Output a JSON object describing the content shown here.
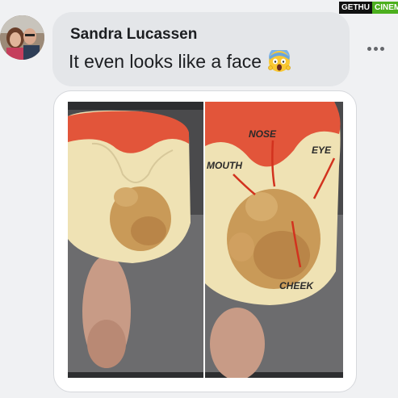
{
  "watermark": {
    "left": "GETHU",
    "right": "CINEMA"
  },
  "comment": {
    "author": "Sandra Lucassen",
    "text": "It even looks like a face",
    "emoji_icon": "face-screaming-in-fear-icon",
    "more_icon": "more-options-icon"
  },
  "attachment": {
    "annotations": {
      "nose": "NOSE",
      "eye": "EYE",
      "mouth": "MOUTH",
      "cheek": "CHEEK"
    }
  },
  "colors": {
    "page_bg": "#f0f1f3",
    "bubble_bg": "#e4e6e9",
    "annotation_red": "#d2321e",
    "apple_red": "#e2553a",
    "apple_flesh": "#efe2b4",
    "bruise": "#c99a58"
  }
}
